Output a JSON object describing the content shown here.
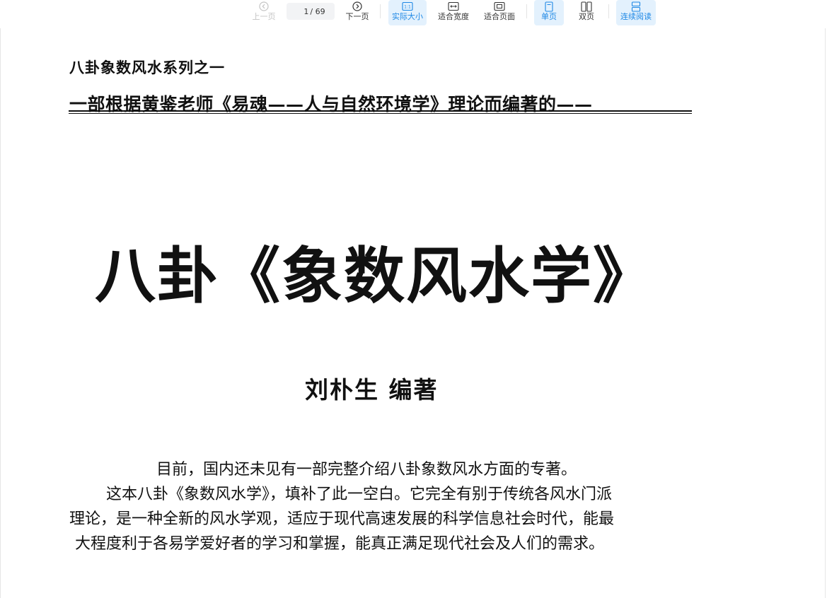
{
  "toolbar": {
    "prev_label": "上一页",
    "next_label": "下一页",
    "page_current": "1",
    "page_total": "/ 69",
    "actual_size_label": "实际大小",
    "actual_size_icon_text": "1:1",
    "fit_width_label": "适合宽度",
    "fit_page_label": "适合页面",
    "single_page_label": "单页",
    "double_page_label": "双页",
    "continuous_label": "连续阅读",
    "accent_color": "#1e88e5"
  },
  "document": {
    "series_line": "八卦象数风水系列之一",
    "subtitle_line": "一部根据黄鉴老师《易魂——人与自然环境学》理论而编著的——",
    "book_title": "八卦《象数风水学》",
    "author_line": "刘朴生 编著",
    "intro_lines": [
      "目前，国内还未见有一部完整介绍八卦象数风水方面的专著。",
      "这本八卦《象数风水学》，填补了此一空白。它完全有别于传统各风水门派",
      "理论，是一种全新的风水学观，适应于现代高速发展的科学信息社会时代，能最",
      "大程度利于各易学爱好者的学习和掌握，能真正满足现代社会及人们的需求。"
    ]
  }
}
